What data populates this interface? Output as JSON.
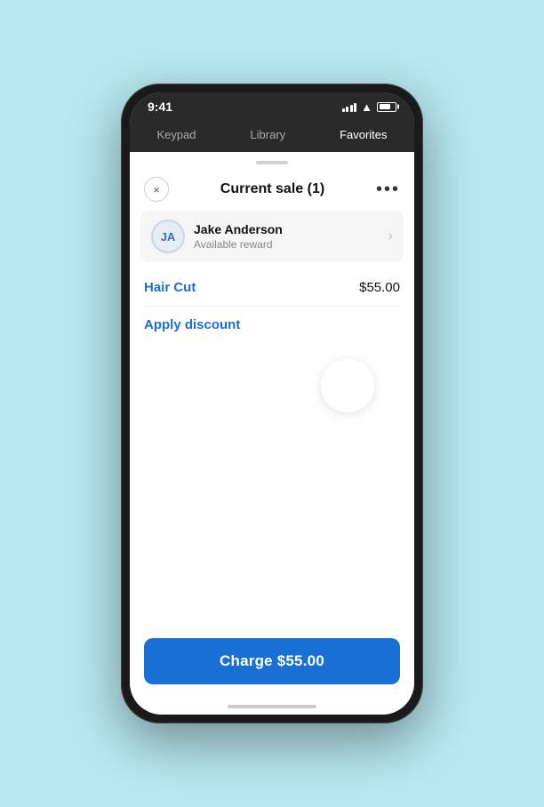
{
  "status_bar": {
    "time": "9:41",
    "signal_bars": [
      4,
      6,
      8,
      10,
      12
    ],
    "wifi": "📶",
    "battery_pct": 75
  },
  "nav": {
    "tabs": [
      {
        "label": "Keypad",
        "active": false
      },
      {
        "label": "Library",
        "active": false
      },
      {
        "label": "Favorites",
        "active": true
      }
    ]
  },
  "header": {
    "close_label": "×",
    "title": "Current sale (1)",
    "more_label": "•••"
  },
  "customer": {
    "initials": "JA",
    "name": "Jake Anderson",
    "sub": "Available reward",
    "chevron": "›"
  },
  "sale_item": {
    "name": "Hair Cut",
    "price": "$55.00"
  },
  "apply_discount_label": "Apply discount",
  "charge_button": {
    "label": "Charge $55.00"
  }
}
